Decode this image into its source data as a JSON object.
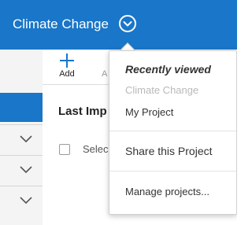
{
  "header": {
    "project_title": "Climate Change",
    "toggle_icon": "chevron-down-circle-icon"
  },
  "toolbar": {
    "add_label": "Add",
    "add_icon": "plus-icon",
    "next_label_fragment": "A"
  },
  "main": {
    "section_heading": "Last Imp",
    "select_label": "Selec"
  },
  "sidebar": {
    "rows": [
      {
        "icon": "chevron-down-icon"
      },
      {
        "icon": "chevron-down-icon"
      },
      {
        "icon": "chevron-down-icon"
      }
    ]
  },
  "menu": {
    "heading": "Recently viewed",
    "recent_items": [
      {
        "label": "Climate Change",
        "state": "current"
      },
      {
        "label": "My Project",
        "state": "normal"
      }
    ],
    "share_label": "Share this Project",
    "manage_label": "Manage projects..."
  },
  "colors": {
    "brand_blue": "#1976c8",
    "disabled_text": "#b9b9b9",
    "text": "#333333"
  }
}
